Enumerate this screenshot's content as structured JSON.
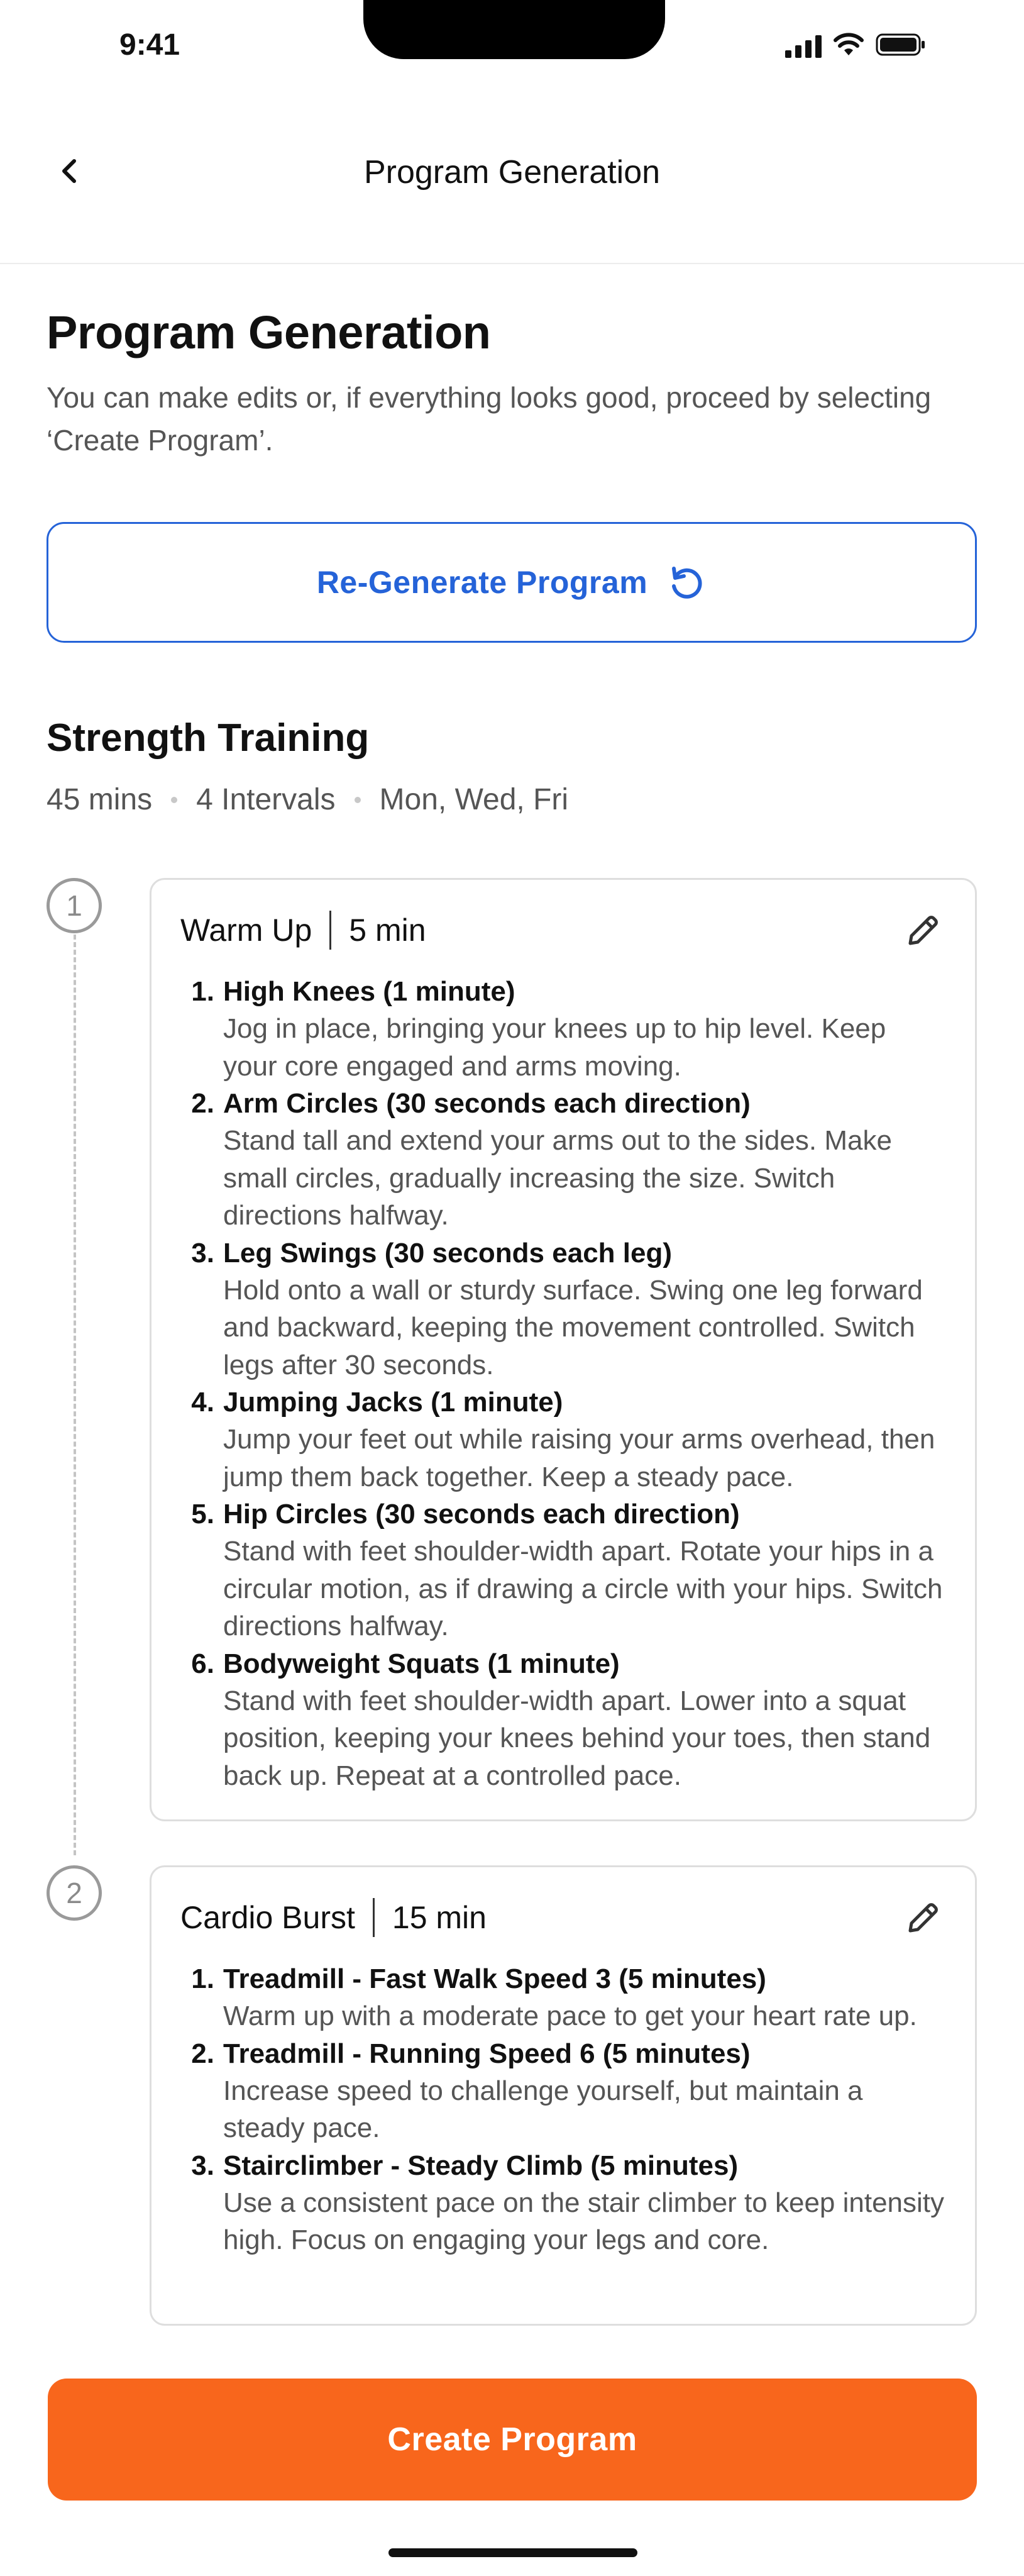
{
  "status_bar": {
    "time": "9:41",
    "icons": [
      "signal-icon",
      "wifi-icon",
      "battery-icon"
    ]
  },
  "header": {
    "title": "Program Generation",
    "back_icon": "chevron-left-icon"
  },
  "intro": {
    "title": "Program Generation",
    "subtitle": "You can make edits or, if everything looks good, proceed by selecting ‘Create Program’."
  },
  "regenerate": {
    "label": "Re-Generate Program",
    "icon": "refresh-icon"
  },
  "program": {
    "title": "Strength Training",
    "duration": "45 mins",
    "intervals": "4 Intervals",
    "days": "Mon, Wed, Fri",
    "steps": [
      {
        "number": "1",
        "name": "Warm Up",
        "duration": "5 min",
        "edit_icon": "pencil-icon",
        "exercises": [
          {
            "num": "1.",
            "name": "High Knees (1 minute)",
            "desc": "Jog in place, bringing your knees up to hip level. Keep your core engaged and arms moving."
          },
          {
            "num": "2.",
            "name": "Arm Circles (30 seconds each direction)",
            "desc": "Stand tall and extend your arms out to the sides. Make small circles, gradually increasing the size. Switch directions halfway."
          },
          {
            "num": "3.",
            "name": "Leg Swings (30 seconds each leg)",
            "desc": "Hold onto a wall or sturdy surface. Swing one leg forward and backward, keeping the movement controlled. Switch legs after 30 seconds."
          },
          {
            "num": "4.",
            "name": "Jumping Jacks (1 minute)",
            "desc": "Jump your feet out while raising your arms overhead, then jump them back together. Keep a steady pace."
          },
          {
            "num": "5.",
            "name": "Hip Circles (30 seconds each direction)",
            "desc": "Stand with feet shoulder-width apart. Rotate your hips in a circular motion, as if drawing a circle with your hips. Switch directions halfway."
          },
          {
            "num": "6.",
            "name": "Bodyweight Squats (1 minute)",
            "desc": "Stand with feet shoulder-width apart. Lower into a squat position, keeping your knees behind your toes, then stand back up. Repeat at a controlled pace."
          }
        ]
      },
      {
        "number": "2",
        "name": "Cardio Burst",
        "duration": "15 min",
        "edit_icon": "pencil-icon",
        "exercises": [
          {
            "num": "1.",
            "name": "Treadmill - Fast Walk Speed 3 (5 minutes)",
            "desc": "Warm up with a moderate pace to get your heart rate up."
          },
          {
            "num": "2.",
            "name": "Treadmill - Running Speed 6 (5 minutes)",
            "desc": "Increase speed to challenge yourself, but maintain a steady pace."
          },
          {
            "num": "3.",
            "name": "Stairclimber - Steady Climb (5 minutes)",
            "desc": "Use a consistent pace on the stair climber to keep intensity high. Focus on engaging your legs and core."
          }
        ]
      }
    ]
  },
  "create_button": {
    "label": "Create Program"
  },
  "colors": {
    "accent_blue": "#2563d8",
    "accent_orange": "#f8661c",
    "text_primary": "#111111",
    "text_secondary": "#555555",
    "border": "#dedede"
  }
}
